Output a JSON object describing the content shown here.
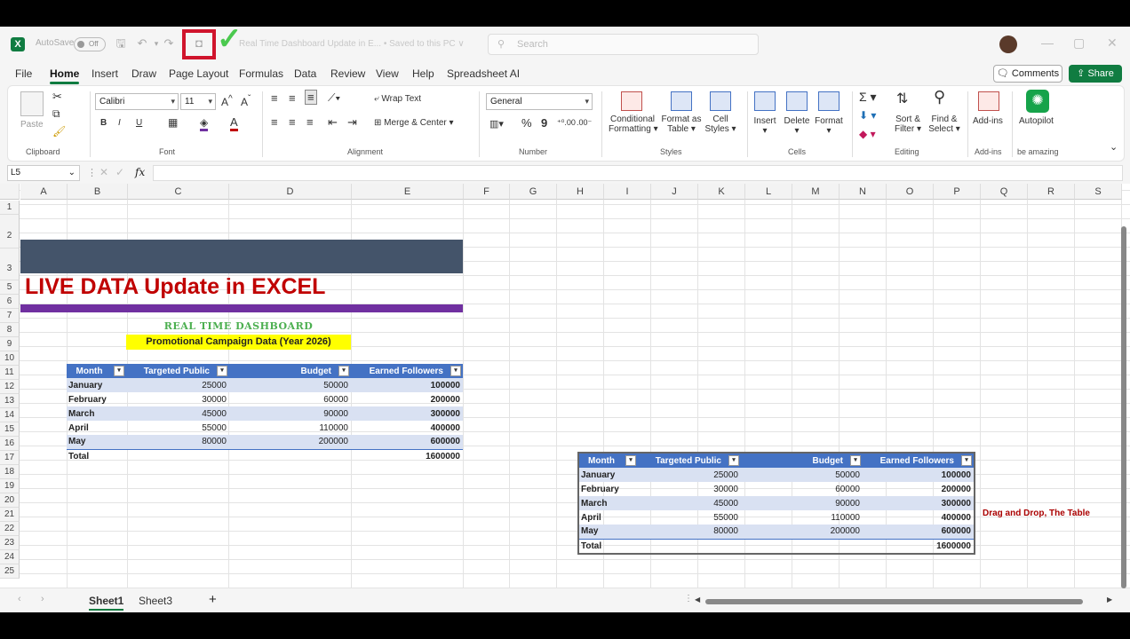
{
  "titlebar": {
    "autosave_label": "AutoSave",
    "autosave_state": "Off",
    "doc_title": "Real Time Dashboard Update in E...  •  Saved to this PC ∨",
    "search_placeholder": "Search"
  },
  "menu": [
    "File",
    "Home",
    "Insert",
    "Draw",
    "Page Layout",
    "Formulas",
    "Data",
    "Review",
    "View",
    "Help",
    "Spreadsheet AI"
  ],
  "menu_active": "Home",
  "buttons": {
    "comments": "Comments",
    "share": "Share"
  },
  "ribbon": {
    "clipboard": {
      "paste": "Paste",
      "group": "Clipboard"
    },
    "font": {
      "name": "Calibri",
      "size": "11",
      "group": "Font"
    },
    "alignment": {
      "wrap_text": "Wrap Text",
      "merge_center": "Merge & Center",
      "group": "Alignment"
    },
    "number": {
      "format": "General",
      "group": "Number"
    },
    "styles": {
      "conditional_1": "Conditional",
      "conditional_2": "Formatting",
      "format_table_1": "Format as",
      "format_table_2": "Table",
      "cell_styles_1": "Cell",
      "cell_styles_2": "Styles",
      "group": "Styles"
    },
    "cells": {
      "insert": "Insert",
      "delete": "Delete",
      "format": "Format",
      "group": "Cells"
    },
    "editing": {
      "sort_1": "Sort &",
      "sort_2": "Filter",
      "find_1": "Find &",
      "find_2": "Select",
      "group": "Editing"
    },
    "addins": {
      "label": "Add-ins",
      "group": "Add-ins"
    },
    "autopilot": {
      "label": "Autopilot",
      "group": "be amazing"
    }
  },
  "formula_bar": {
    "name_box": "L5",
    "fx": "fx",
    "content": ""
  },
  "columns": [
    "A",
    "B",
    "C",
    "D",
    "E",
    "F",
    "G",
    "H",
    "I",
    "J",
    "K",
    "L",
    "M",
    "N",
    "O",
    "P",
    "Q",
    "R",
    "S"
  ],
  "rows": [
    "1",
    "2",
    "3",
    "5",
    "6",
    "7",
    "8",
    "9",
    "10",
    "11",
    "12",
    "13",
    "14",
    "15",
    "16",
    "17",
    "18",
    "19",
    "20",
    "21",
    "22",
    "23",
    "24",
    "25"
  ],
  "sheet": {
    "title": "LIVE DATA Update in EXCEL",
    "subtitle": "REAL TIME DASHBOARD",
    "caption": "Promotional Campaign Data (Year 2026)",
    "table": {
      "headers": [
        "Month",
        "Targeted Public",
        "Budget",
        "Earned Followers"
      ],
      "rows": [
        [
          "January",
          "25000",
          "50000",
          "100000"
        ],
        [
          "February",
          "30000",
          "60000",
          "200000"
        ],
        [
          "March",
          "45000",
          "90000",
          "300000"
        ],
        [
          "April",
          "55000",
          "110000",
          "400000"
        ],
        [
          "May",
          "80000",
          "200000",
          "600000"
        ]
      ],
      "total_label": "Total",
      "total_value": "1600000"
    },
    "note": "Drag and Drop, The Table"
  },
  "sheet_tabs": [
    "Sheet1",
    "Sheet3"
  ],
  "active_tab": "Sheet1",
  "colors": {
    "excel_green": "#107c41",
    "table_header": "#4472c4",
    "band": "#d9e1f2",
    "title_red": "#c00000",
    "banner": "#44546a",
    "purple": "#7030a0",
    "highlight_yellow": "#ffff00"
  }
}
